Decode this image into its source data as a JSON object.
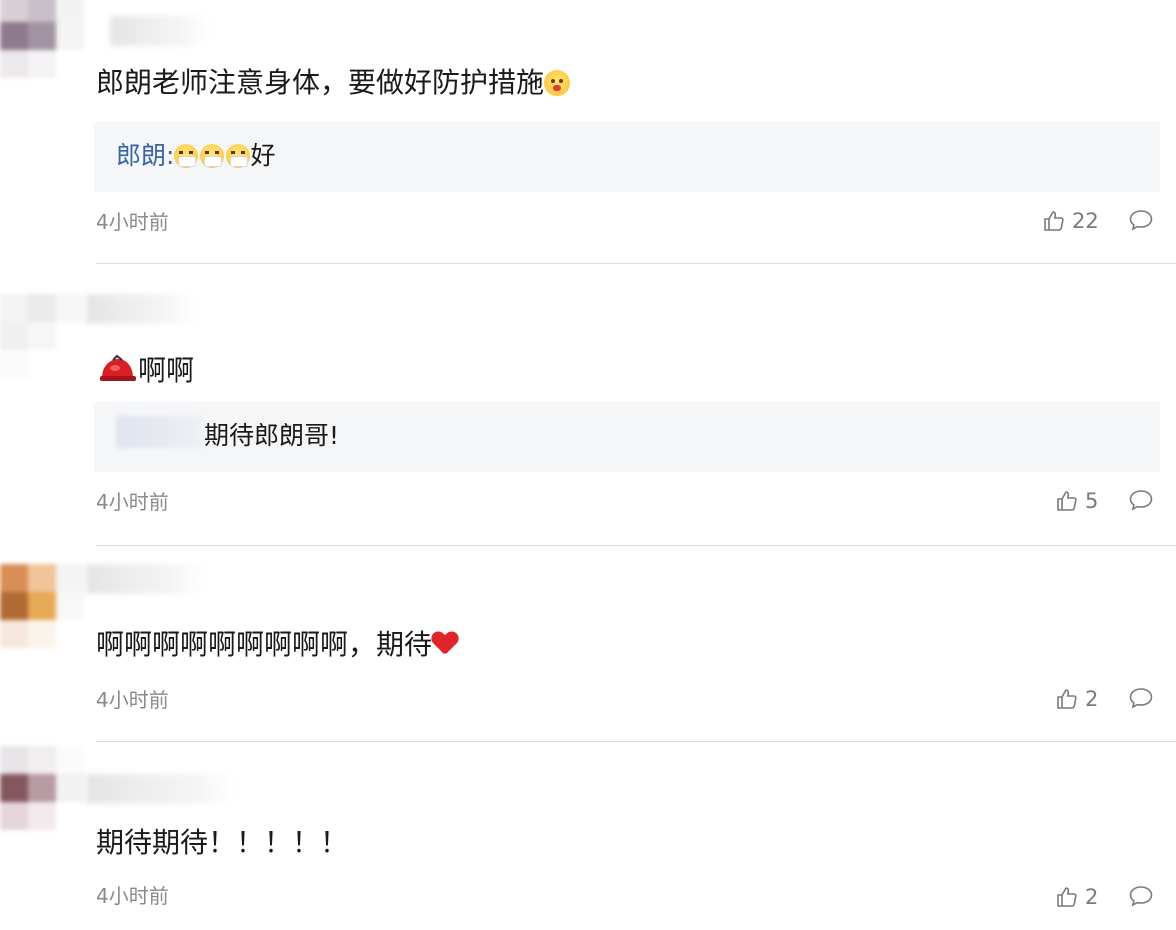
{
  "comments": [
    {
      "text": "郎朗老师注意身体，要做好防护措施",
      "text_emoji": "face-open-mouth-emoji",
      "reply": {
        "name": "郎朗",
        "separator": ":",
        "emojis": [
          "mask-face-emoji",
          "mask-face-emoji",
          "mask-face-emoji"
        ],
        "text": "好"
      },
      "time": "4小时前",
      "likes": "22"
    },
    {
      "badge_icon": "red-helmet-icon",
      "text": "啊啊",
      "reply": {
        "name_hidden": true,
        "text": "期待郎朗哥!"
      },
      "time": "4小时前",
      "likes": "5"
    },
    {
      "text": "啊啊啊啊啊啊啊啊啊，期待",
      "text_emoji": "red-heart-emoji",
      "time": "4小时前",
      "likes": "2"
    },
    {
      "text": "期待期待！！！！！",
      "time": "4小时前",
      "likes": "2"
    }
  ],
  "colors": {
    "reply_name": "#3b64a8",
    "meta_gray": "#8a8a8a",
    "reply_bg": "#f5f6f8",
    "divider": "#dcdcdc"
  }
}
